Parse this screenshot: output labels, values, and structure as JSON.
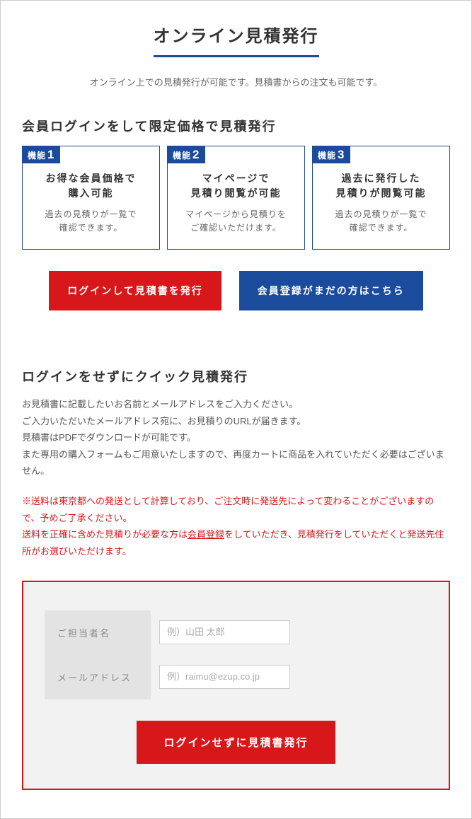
{
  "page": {
    "title": "オンライン見積発行",
    "description": "オンライン上での見積発行が可能です。見積書からの注文も可能です。"
  },
  "section1": {
    "title": "会員ログインをして限定価格で見積発行",
    "features": [
      {
        "badge_label": "機能",
        "badge_num": "1",
        "title_line1": "お得な会員価格で",
        "title_line2": "購入可能",
        "desc_line1": "過去の見積りが一覧で",
        "desc_line2": "確認できます。"
      },
      {
        "badge_label": "機能",
        "badge_num": "2",
        "title_line1": "マイページで",
        "title_line2": "見積り閲覧が可能",
        "desc_line1": "マイページから見積りを",
        "desc_line2": "ご確認いただけます。"
      },
      {
        "badge_label": "機能",
        "badge_num": "3",
        "title_line1": "過去に発行した",
        "title_line2": "見積りが閲覧可能",
        "desc_line1": "過去の見積りが一覧で",
        "desc_line2": "確認できます。"
      }
    ],
    "login_button": "ログインして見積書を発行",
    "register_button": "会員登録がまだの方はこちら"
  },
  "section2": {
    "title": "ログインをせずにクイック見積発行",
    "desc_line1": "お見積書に記載したいお名前とメールアドレスをご入力ください。",
    "desc_line2": "ご入力いただいたメールアドレス宛に、お見積りのURLが届きます。",
    "desc_line3": "見積書はPDFでダウンロードが可能です。",
    "desc_line4": "また専用の購入フォームもご用意いたしますので、再度カートに商品を入れていただく必要はございません。",
    "notice_line1": "※送料は東京都への発送として計算しており、ご注文時に発送先によって変わることがございますので、予めご了承ください。",
    "notice_line2_pre": "送料を正確に含めた見積りが必要な方は",
    "notice_line2_link": "会員登録",
    "notice_line2_post": "をしていただき、見積発行をしていただくと発送先住所がお選びいただけます。",
    "form": {
      "name_label": "ご担当者名",
      "name_placeholder": "例）山田 太郎",
      "email_label": "メールアドレス",
      "email_placeholder": "例）raimu@ezup.co.jp",
      "submit": "ログインせずに見積書発行"
    }
  }
}
